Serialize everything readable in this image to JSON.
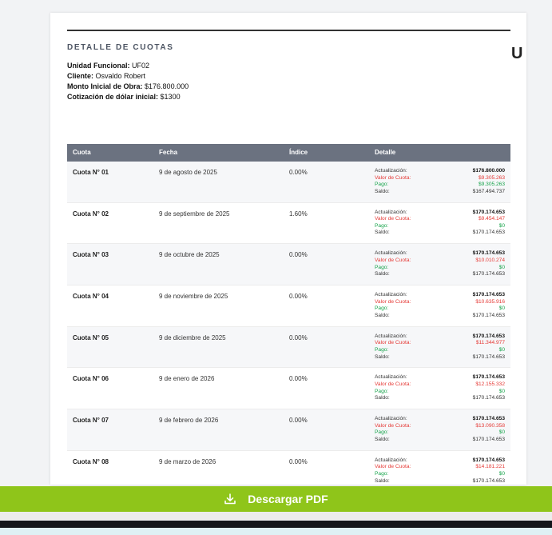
{
  "document": {
    "title": "DETALLE DE CUOTAS",
    "truncated_header_letter": "U",
    "info": [
      {
        "label": "Unidad Funcional:",
        "value": "UF02"
      },
      {
        "label": "Cliente:",
        "value": "Osvaldo Robert"
      },
      {
        "label": "Monto Inicial de Obra:",
        "value": "$176.800.000"
      },
      {
        "label": "Cotización de dólar inicial:",
        "value": "$1300"
      }
    ]
  },
  "table": {
    "headers": [
      "Cuota",
      "Fecha",
      "Índice",
      "Detalle"
    ],
    "detail_labels": {
      "actualizacion": "Actualización:",
      "valor_cuota": "Valor de Cuota:",
      "pago": "Pago:",
      "saldo": "Saldo:"
    },
    "rows": [
      {
        "cuota": "Cuota N° 01",
        "fecha": "9 de agosto de 2025",
        "indice": "0.00%",
        "actualizacion": "$176.800.000",
        "valor_cuota": "$9.305.263",
        "pago": "$9.305.263",
        "saldo": "$167.494.737"
      },
      {
        "cuota": "Cuota N° 02",
        "fecha": "9 de septiembre de 2025",
        "indice": "1.60%",
        "actualizacion": "$170.174.653",
        "valor_cuota": "$9.454.147",
        "pago": "$0",
        "saldo": "$170.174.653"
      },
      {
        "cuota": "Cuota N° 03",
        "fecha": "9 de octubre de 2025",
        "indice": "0.00%",
        "actualizacion": "$170.174.653",
        "valor_cuota": "$10.010.274",
        "pago": "$0",
        "saldo": "$170.174.653"
      },
      {
        "cuota": "Cuota N° 04",
        "fecha": "9 de noviembre de 2025",
        "indice": "0.00%",
        "actualizacion": "$170.174.653",
        "valor_cuota": "$10.635.916",
        "pago": "$0",
        "saldo": "$170.174.653"
      },
      {
        "cuota": "Cuota N° 05",
        "fecha": "9 de diciembre de 2025",
        "indice": "0.00%",
        "actualizacion": "$170.174.653",
        "valor_cuota": "$11.344.977",
        "pago": "$0",
        "saldo": "$170.174.653"
      },
      {
        "cuota": "Cuota N° 06",
        "fecha": "9 de enero de 2026",
        "indice": "0.00%",
        "actualizacion": "$170.174.653",
        "valor_cuota": "$12.155.332",
        "pago": "$0",
        "saldo": "$170.174.653"
      },
      {
        "cuota": "Cuota N° 07",
        "fecha": "9 de febrero de 2026",
        "indice": "0.00%",
        "actualizacion": "$170.174.653",
        "valor_cuota": "$13.090.358",
        "pago": "$0",
        "saldo": "$170.174.653"
      },
      {
        "cuota": "Cuota N° 08",
        "fecha": "9 de marzo de 2026",
        "indice": "0.00%",
        "actualizacion": "$170.174.653",
        "valor_cuota": "$14.181.221",
        "pago": "$0",
        "saldo": "$170.174.653"
      }
    ]
  },
  "download_button": {
    "label": "Descargar PDF",
    "icon": "download-icon"
  },
  "colors": {
    "header_bg": "#6b7280",
    "button_bg": "#8fc51a",
    "red": "#e53935",
    "green": "#16a34a"
  }
}
